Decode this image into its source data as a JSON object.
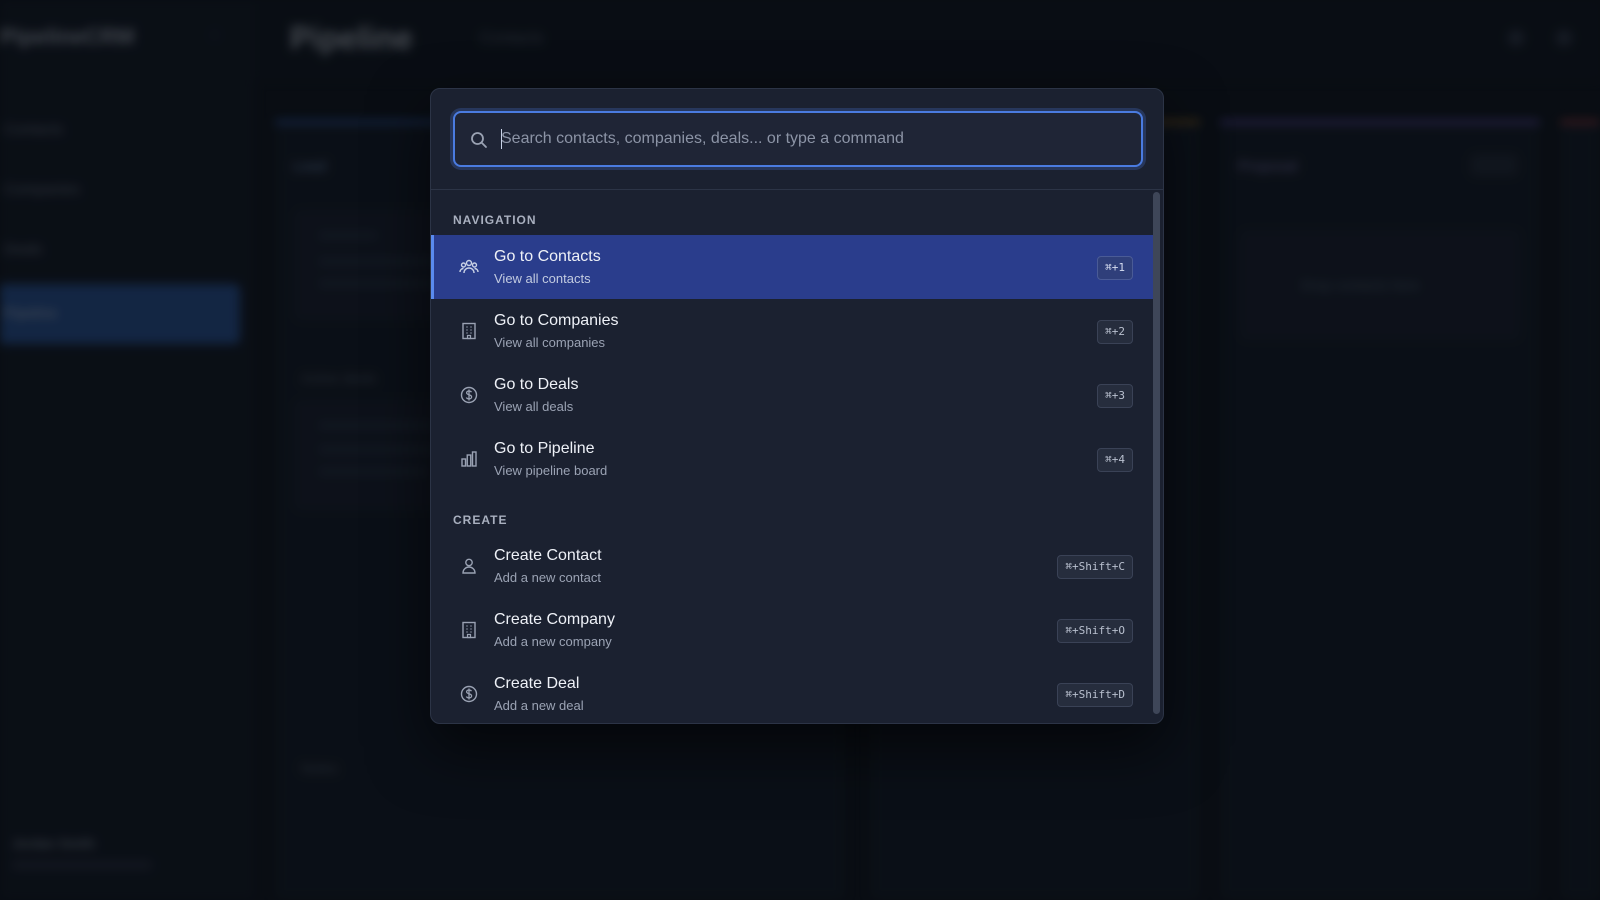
{
  "background": {
    "brand": "PipelineCRM",
    "nav": [
      "Contacts",
      "Companies",
      "Deals",
      "Pipeline"
    ],
    "page_title": "Pipeline",
    "breadcrumb": "Contacts",
    "columns": [
      "Lead",
      "Proposal"
    ],
    "ghost_sections": [
      "Active deals",
      "Upcoming",
      "Notes"
    ],
    "drop_hint": "Drop contacts here",
    "user_name": "Jordan Smith"
  },
  "search": {
    "placeholder": "Search contacts, companies, deals... or type a command",
    "value": ""
  },
  "sections": [
    {
      "label": "NAVIGATION",
      "items": [
        {
          "title": "Go to Contacts",
          "subtitle": "View all contacts",
          "shortcut": "⌘+1",
          "icon": "users-icon",
          "active": true
        },
        {
          "title": "Go to Companies",
          "subtitle": "View all companies",
          "shortcut": "⌘+2",
          "icon": "building-icon",
          "active": false
        },
        {
          "title": "Go to Deals",
          "subtitle": "View all deals",
          "shortcut": "⌘+3",
          "icon": "dollar-icon",
          "active": false
        },
        {
          "title": "Go to Pipeline",
          "subtitle": "View pipeline board",
          "shortcut": "⌘+4",
          "icon": "bar-chart-icon",
          "active": false
        }
      ]
    },
    {
      "label": "CREATE",
      "items": [
        {
          "title": "Create Contact",
          "subtitle": "Add a new contact",
          "shortcut": "⌘+Shift+C",
          "icon": "user-icon",
          "active": false
        },
        {
          "title": "Create Company",
          "subtitle": "Add a new company",
          "shortcut": "⌘+Shift+O",
          "icon": "building-icon",
          "active": false
        },
        {
          "title": "Create Deal",
          "subtitle": "Add a new deal",
          "shortcut": "⌘+Shift+D",
          "icon": "dollar-icon",
          "active": false
        }
      ]
    }
  ],
  "colors": {
    "accent": "#4a7be0",
    "active_row": "#2a3d8c",
    "panel": "#1b2130"
  }
}
